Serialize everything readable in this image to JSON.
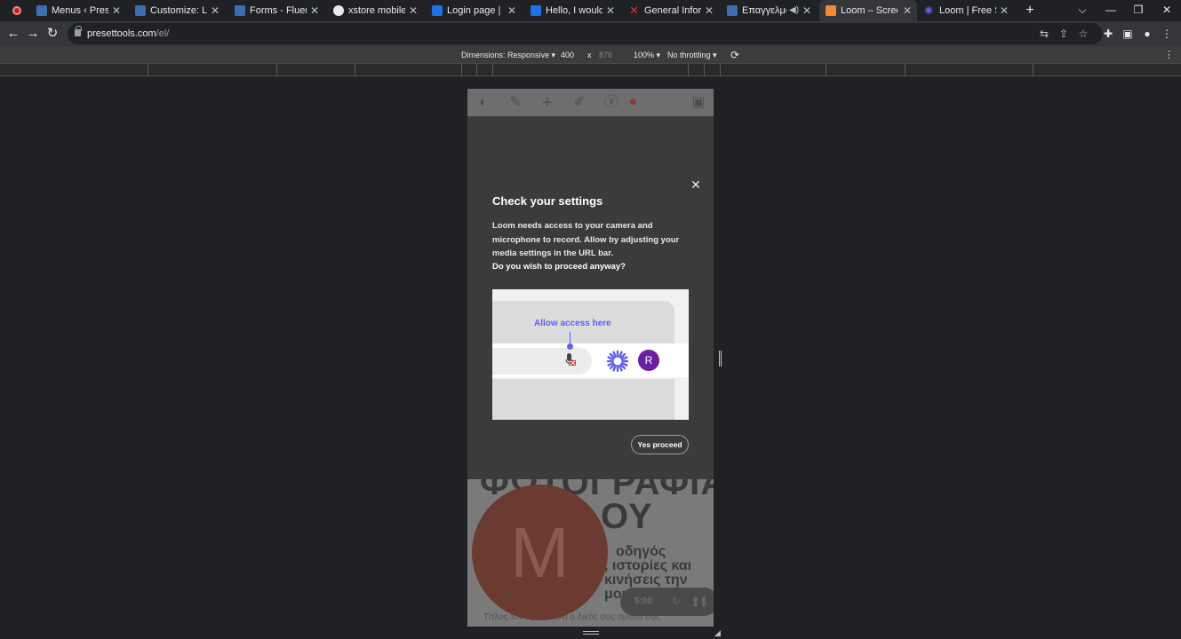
{
  "tabs": [
    {
      "label": "Menus ‹ PresetTo",
      "fav_color": "#3b6db3"
    },
    {
      "label": "Customize: Lighti",
      "fav_color": "#3b6db3"
    },
    {
      "label": "Forms - FluentFo",
      "fav_color": "#3b6db3"
    },
    {
      "label": "xstore mobile me",
      "fav_color": "#e8eaed"
    },
    {
      "label": "Login page | Sign",
      "fav_color": "#1a73e8"
    },
    {
      "label": "Hello, I would lik",
      "fav_color": "#1a73e8"
    },
    {
      "label": "General Informati",
      "fav_color": "#d93025"
    },
    {
      "label": "Επαγγελματι",
      "fav_color": "#3b6db3"
    },
    {
      "label": "Loom – Screen R",
      "fav_color": "#f28b30"
    },
    {
      "label": "Loom | Free Scree",
      "fav_color": "#625df5"
    }
  ],
  "tab_close_glyph": "✕",
  "new_tab_glyph": "+",
  "window": {
    "tab_search": "⌵",
    "minimize": "—",
    "restore": "❐",
    "close": "✕"
  },
  "url": {
    "host": "presettools.com",
    "path": "/el/"
  },
  "devtools": {
    "dimensions": "Dimensions: Responsive",
    "width": "400",
    "times": "x",
    "height": "876",
    "zoom": "100%",
    "throttling": "No throttling",
    "more": "⋮"
  },
  "page": {
    "title_line1": "ΦΩΤΟΓΡΑΦΙΑ",
    "title_line2": "ΟΥ",
    "body_lines": [
      "οδηγός",
      ", ιστορίες και",
      "κινήσεις την",
      "μου!"
    ],
    "small_text": "Τίτλος τον προσθέσει ο δικός σας ομάδα σας",
    "bubble_letter": "M",
    "rec_time": "5:00"
  },
  "modal": {
    "close_glyph": "✕",
    "title": "Check your settings",
    "text": "Loom needs access to your camera and microphone to record. Allow by adjusting your media settings in the URL bar.",
    "question": "Do you wish to proceed anyway?",
    "illustration_label": "Allow access here",
    "avatar_letter": "R",
    "proceed_label": "Yes proceed"
  },
  "colors": {
    "accent": "#625df5",
    "avatar": "#6b1fa3",
    "record": "#c5221f"
  }
}
